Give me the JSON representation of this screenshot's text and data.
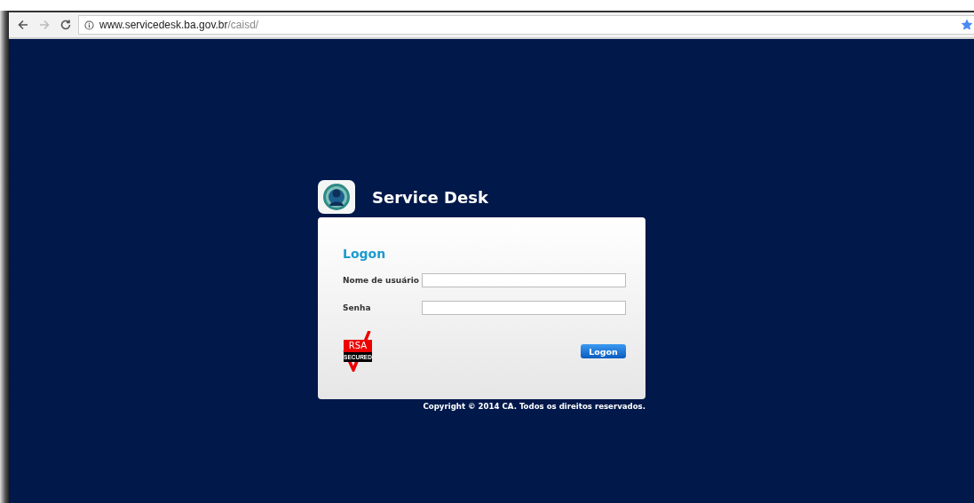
{
  "browser": {
    "url_host": "www.servicedesk.ba.gov.br",
    "url_path": "/caisd/",
    "bookmarked": true
  },
  "header": {
    "title": "Service Desk"
  },
  "login": {
    "heading": "Logon",
    "fields": [
      {
        "label": "Nome de usuário"
      },
      {
        "label": "Senha"
      }
    ],
    "badge": {
      "title": "RSA",
      "subtitle": "SECURED"
    },
    "button": "Logon"
  },
  "footer": "Copyright © 2014 CA. Todos os direitos reservados."
}
